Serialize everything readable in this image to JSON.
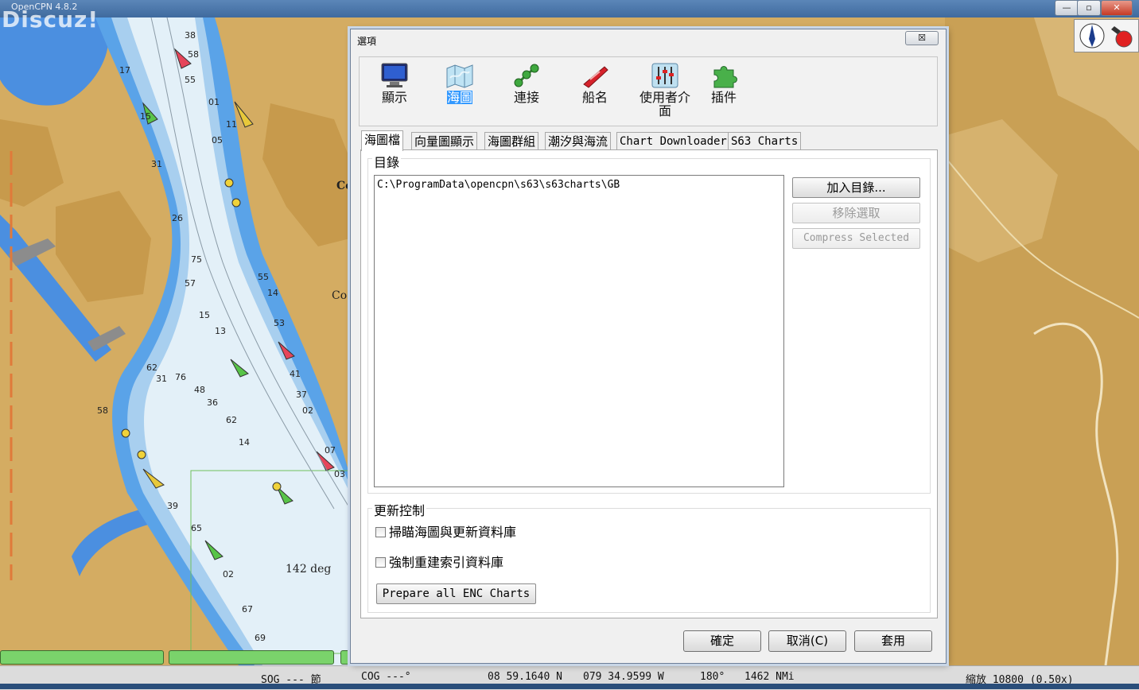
{
  "app": {
    "title": "OpenCPN 4.8.2",
    "watermark": "Discuz!"
  },
  "window_controls": {
    "minimize": "—",
    "maximize": "▫",
    "close": "✕"
  },
  "map": {
    "heading_label": "142 deg",
    "place_label_1": "Co",
    "place_label_2": "Co"
  },
  "status": {
    "sog": "SOG --- 節",
    "cog": "COG ---°",
    "lat": "08 59.1640 N",
    "lon": "079 34.9599 W",
    "brg": "180°",
    "dist": "1462 NMi",
    "zoom": "縮放 10800 (0.50x)"
  },
  "dialog": {
    "title": "選項",
    "close": "☒",
    "toolbar": [
      {
        "label": "顯示",
        "icon": "monitor-icon"
      },
      {
        "label": "海圖",
        "icon": "chart-map-icon",
        "active": true
      },
      {
        "label": "連接",
        "icon": "connections-icon"
      },
      {
        "label": "船名",
        "icon": "ship-icon"
      },
      {
        "label": "使用者介面",
        "icon": "sliders-icon"
      },
      {
        "label": "插件",
        "icon": "puzzle-icon"
      }
    ],
    "tabs": [
      "海圖檔",
      "向量圖顯示",
      "海圖群組",
      "潮汐與海流",
      "Chart Downloader",
      "S63 Charts"
    ],
    "directories": {
      "label": "目錄",
      "items": [
        "C:\\ProgramData\\opencpn\\s63\\s63charts\\GB"
      ],
      "add_button": "加入目錄...",
      "remove_button": "移除選取",
      "compress_button": "Compress Selected"
    },
    "update_control": {
      "label": "更新控制",
      "scan_checkbox": "掃瞄海圖與更新資料庫",
      "rebuild_checkbox": "強制重建索引資料庫",
      "prepare_button": "Prepare all ENC Charts"
    },
    "footer": {
      "ok": "確定",
      "cancel": "取消(C)",
      "apply": "套用"
    }
  }
}
